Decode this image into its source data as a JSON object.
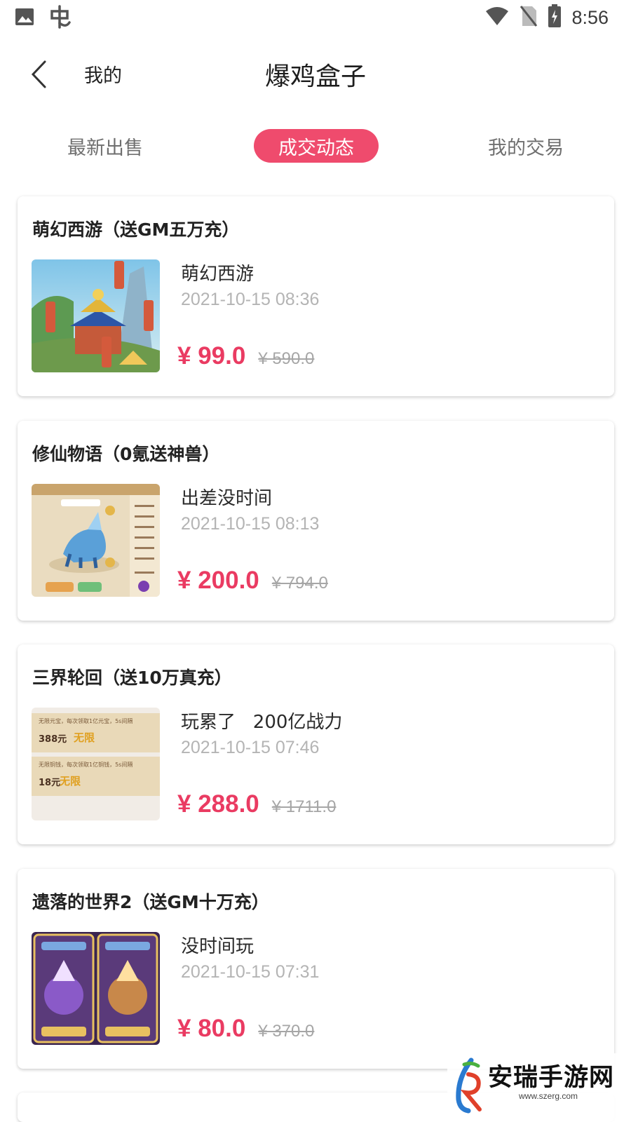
{
  "status_bar": {
    "time": "8:56"
  },
  "header": {
    "back_label": "我的",
    "title": "爆鸡盒子"
  },
  "tabs": [
    {
      "label": "最新出售",
      "active": false
    },
    {
      "label": "成交动态",
      "active": true
    },
    {
      "label": "我的交易",
      "active": false
    }
  ],
  "listings": [
    {
      "game": "萌幻西游（送GM五万充）",
      "seller": "萌幻西游",
      "time": "2021-10-15 08:36",
      "price": "¥ 99.0",
      "original_price": "¥ 590.0"
    },
    {
      "game": "修仙物语（0氪送神兽）",
      "seller": "出差没时间",
      "time": "2021-10-15 08:13",
      "price": "¥ 200.0",
      "original_price": "¥ 794.0"
    },
    {
      "game": "三界轮回（送10万真充）",
      "seller": "玩累了   200亿战力",
      "time": "2021-10-15 07:46",
      "price": "¥ 288.0",
      "original_price": "¥ 1711.0",
      "thumb_text": {
        "line1": "无限元宝，每次领取1亿元宝，5s间隔",
        "amount1": "388元",
        "tag1": "无限",
        "line2": "无限铜钱，每次领取1亿铜钱，5s间隔",
        "amount2": "18元",
        "tag2": "无限"
      }
    },
    {
      "game": "遗落的世界2（送GM十万充）",
      "seller": "没时间玩",
      "time": "2021-10-15 07:31",
      "price": "¥ 80.0",
      "original_price": "¥ 370.0"
    }
  ],
  "watermark": {
    "text": "安瑞手游网",
    "url": "www.szerg.com"
  },
  "colors": {
    "accent": "#ef4b6d",
    "price": "#ea3b62",
    "muted": "#b4b4b4"
  }
}
